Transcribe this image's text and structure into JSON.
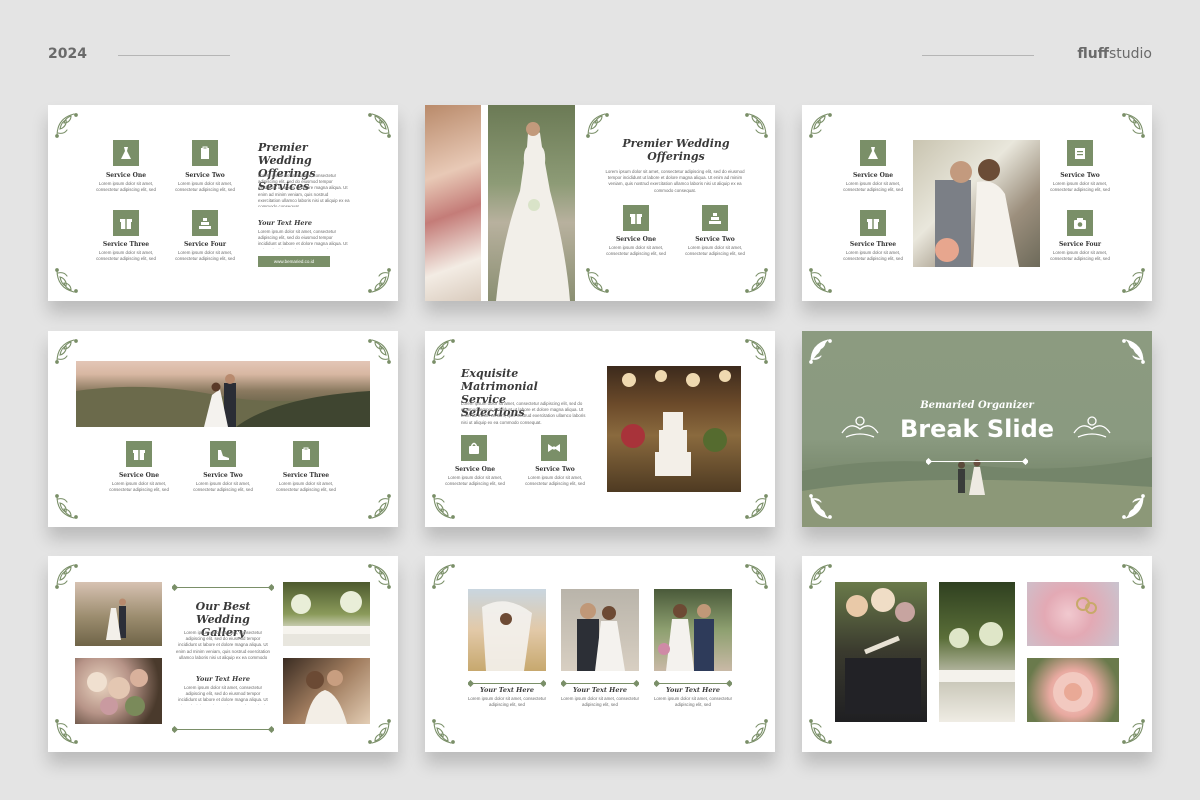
{
  "header": {
    "year": "2024",
    "brand_bold": "fluff",
    "brand_light": "studio"
  },
  "colors": {
    "accent": "#7a8f68",
    "background": "#e4e4e4"
  },
  "lorem": "Lorem ipsum dolor sit amet, consectetur adipiscing elit, sed do eiusmod tempor incididunt ut labore et dolore magna aliqua. Ut enim ad minim veniam, quis nostrud exercitation ullamco laboris nisi ut aliquip ex ea commodo consequat.",
  "short_lorem": "Lorem ipsum dolor sit amet, consectetur adipiscing elit, sed",
  "slide1": {
    "title": "Premier Wedding Offerings Services",
    "services": [
      "Service One",
      "Service Two",
      "Service Three",
      "Service Four"
    ],
    "your_text": "Your Text Here",
    "button": "www.bemaried.co.id"
  },
  "slide2": {
    "title": "Premier Wedding Offerings",
    "services": [
      "Service One",
      "Service Two"
    ]
  },
  "slide3": {
    "services": [
      "Service One",
      "Service Two",
      "Service Three",
      "Service Four"
    ]
  },
  "slide4": {
    "services": [
      "Service One",
      "Service Two",
      "Service Three"
    ]
  },
  "slide5": {
    "title": "Exquisite Matrimonial Service Selections",
    "services": [
      "Service One",
      "Service Two"
    ]
  },
  "slide6": {
    "subtitle": "Bemaried Organizer",
    "title": "Break Slide"
  },
  "slide7": {
    "title": "Our Best Wedding Gallery",
    "your_text": "Your Text Here"
  },
  "slide8": {
    "captions": [
      "Your Text Here",
      "Your Text Here",
      "Your Text Here"
    ]
  }
}
